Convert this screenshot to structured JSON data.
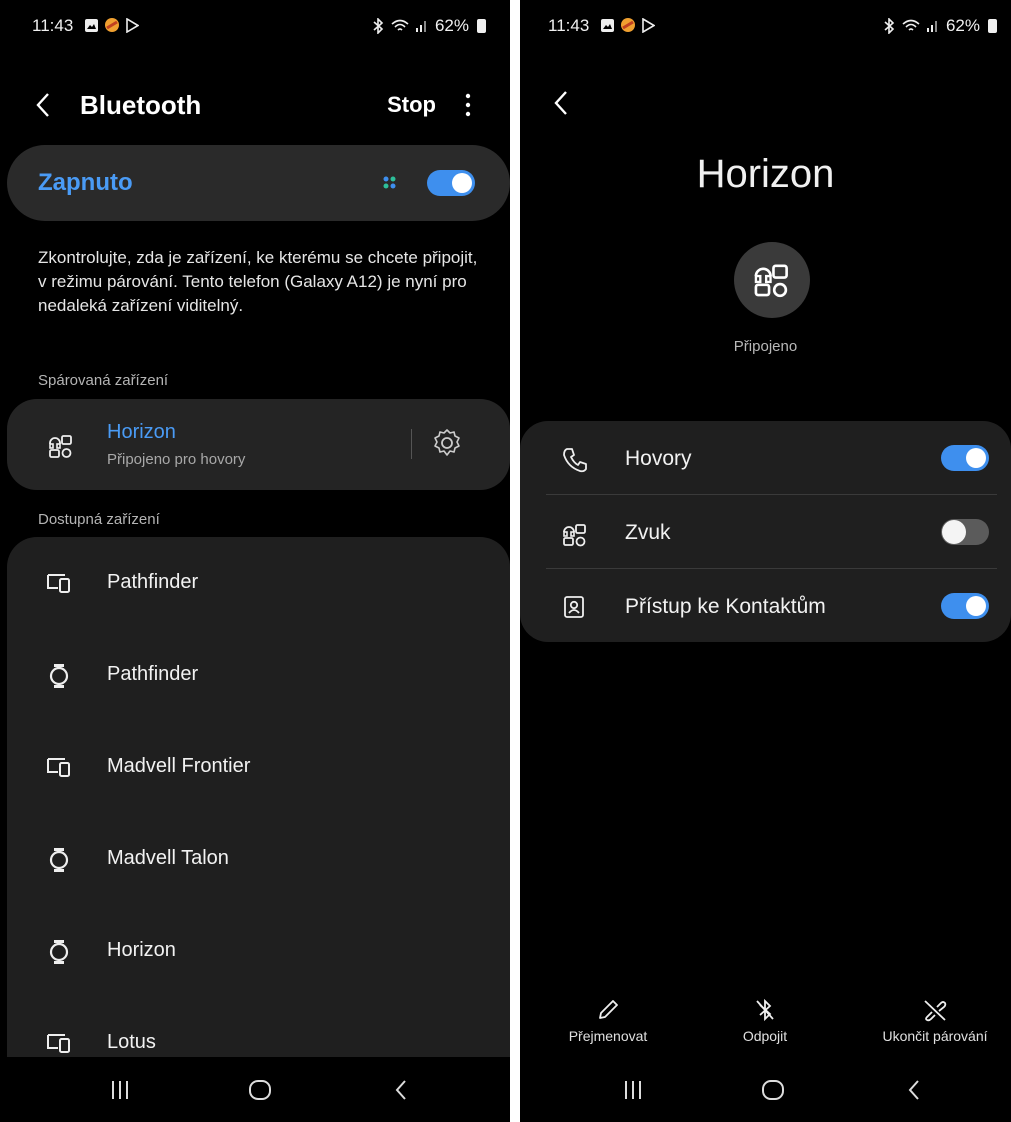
{
  "left": {
    "status": {
      "time": "11:43",
      "battery": "62%"
    },
    "header": {
      "title": "Bluetooth",
      "stop_label": "Stop"
    },
    "toggle": {
      "label": "Zapnuto",
      "on": true
    },
    "description": "Zkontrolujte, zda je zařízení, ke kterému se chcete připojit, v režimu párování. Tento telefon (Galaxy A12) je nyní pro nedaleká zařízení viditelný.",
    "paired": {
      "section_label": "Spárovaná zařízení",
      "device": {
        "name": "Horizon",
        "status": "Připojeno pro hovory",
        "icon": "audio-device-icon"
      }
    },
    "available": {
      "section_label": "Dostupná zařízení",
      "devices": [
        {
          "name": "Pathfinder",
          "icon": "devices-icon"
        },
        {
          "name": "Pathfinder",
          "icon": "watch-icon"
        },
        {
          "name": "Madvell Frontier",
          "icon": "devices-icon"
        },
        {
          "name": "Madvell Talon",
          "icon": "watch-icon"
        },
        {
          "name": "Horizon",
          "icon": "watch-icon"
        },
        {
          "name": "Lotus",
          "icon": "devices-icon"
        }
      ]
    }
  },
  "right": {
    "status": {
      "time": "11:43",
      "battery": "62%"
    },
    "device_title": "Horizon",
    "connection_status": "Připojeno",
    "profiles": [
      {
        "label": "Hovory",
        "icon": "phone-icon",
        "enabled": true
      },
      {
        "label": "Zvuk",
        "icon": "audio-device-icon",
        "enabled": false
      },
      {
        "label": "Přístup ke Kontaktům",
        "icon": "contact-icon",
        "enabled": true
      }
    ],
    "actions": {
      "rename": "Přejmenovat",
      "disconnect": "Odpojit",
      "unpair": "Ukončit párování"
    }
  },
  "colors": {
    "accent": "#3e8fee",
    "accent_text": "#4a9bf5",
    "card": "#1f1f1f",
    "background": "#000000"
  }
}
